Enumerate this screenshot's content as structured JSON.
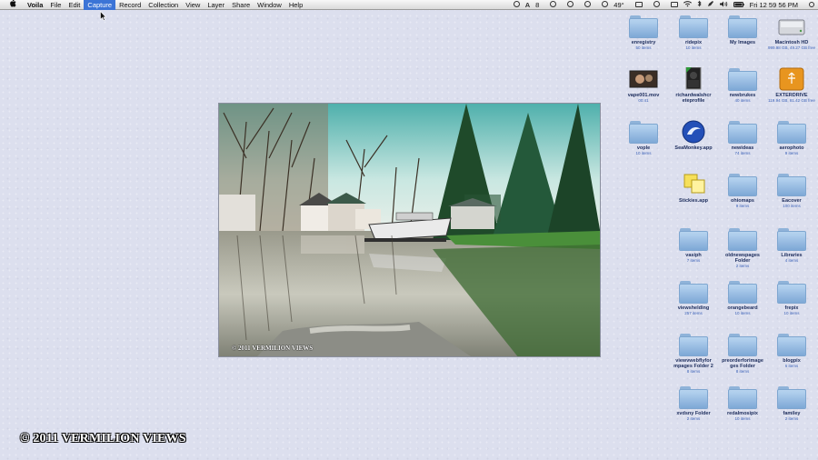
{
  "menubar": {
    "apple": "",
    "items": [
      "Voila",
      "File",
      "Edit",
      "Capture",
      "Record",
      "Collection",
      "View",
      "Layer",
      "Share",
      "Window",
      "Help"
    ],
    "active_item": "Capture",
    "status": {
      "adobe": "A",
      "eight": "8",
      "temp": "49°",
      "clock": "Fri 12 59 56 PM"
    }
  },
  "photo": {
    "caption": "© 2011 VERMILION VIEWS"
  },
  "desktop_icons": [
    {
      "label": "enregistry",
      "sub": "50 items",
      "type": "folder"
    },
    {
      "label": "ridepix",
      "sub": "10 items",
      "type": "folder"
    },
    {
      "label": "My Images",
      "sub": "",
      "type": "folder"
    },
    {
      "label": "Macintosh HD",
      "sub": "999.98 GB, 49.27 GB free",
      "type": "drive"
    },
    {
      "label": "vape001.mov",
      "sub": "00:41",
      "type": "movie"
    },
    {
      "label": "richardwalshcr",
      "label2": "eteprofile",
      "sub": "",
      "type": "doc"
    },
    {
      "label": "newbrukes",
      "sub": "40 items",
      "type": "folder"
    },
    {
      "label": "EXTERDRIVE",
      "sub": "119.94 GB, 81.42 GB free",
      "type": "usb"
    },
    {
      "label": "vople",
      "sub": "10 items",
      "type": "folder"
    },
    {
      "label": "SeaMonkey.app",
      "sub": "",
      "type": "seamonkey"
    },
    {
      "label": "newideas",
      "sub": "74 items",
      "type": "folder"
    },
    {
      "label": "aerophoto",
      "sub": "9 items",
      "type": "folder"
    },
    {
      "label": "Stickies.app",
      "sub": "",
      "type": "stickies"
    },
    {
      "label": "ohiomaps",
      "sub": "9 items",
      "type": "folder"
    },
    {
      "label": "Eacover",
      "sub": "100 items",
      "type": "folder"
    },
    {
      "label": "vasiph",
      "sub": "7 items",
      "type": "folder"
    },
    {
      "label": "oldnewspages",
      "label2": "Folder",
      "sub": "2 items",
      "type": "folder"
    },
    {
      "label": "Libraries",
      "sub": "4 items",
      "type": "folder"
    },
    {
      "label": "viewshelding",
      "sub": "257 items",
      "type": "folder"
    },
    {
      "label": "orangebeard",
      "sub": "10 items",
      "type": "folder"
    },
    {
      "label": "frepix",
      "sub": "10 items",
      "type": "folder"
    },
    {
      "label": "viewvwebflyfor",
      "label2": "mpages Folder 2",
      "sub": "8 items",
      "type": "folder"
    },
    {
      "label": "preorderforimage",
      "label2": "ges Folder",
      "sub": "8 items",
      "type": "folder"
    },
    {
      "label": "blogpix",
      "sub": "6 items",
      "type": "folder"
    },
    {
      "label": "xvdsny Folder",
      "sub": "2 items",
      "type": "folder"
    },
    {
      "label": "redalmosipix",
      "sub": "10 items",
      "type": "folder"
    },
    {
      "label": "familey",
      "sub": "2 items",
      "type": "folder"
    }
  ],
  "watermark": "© 2011 VERMILION VIEWS"
}
